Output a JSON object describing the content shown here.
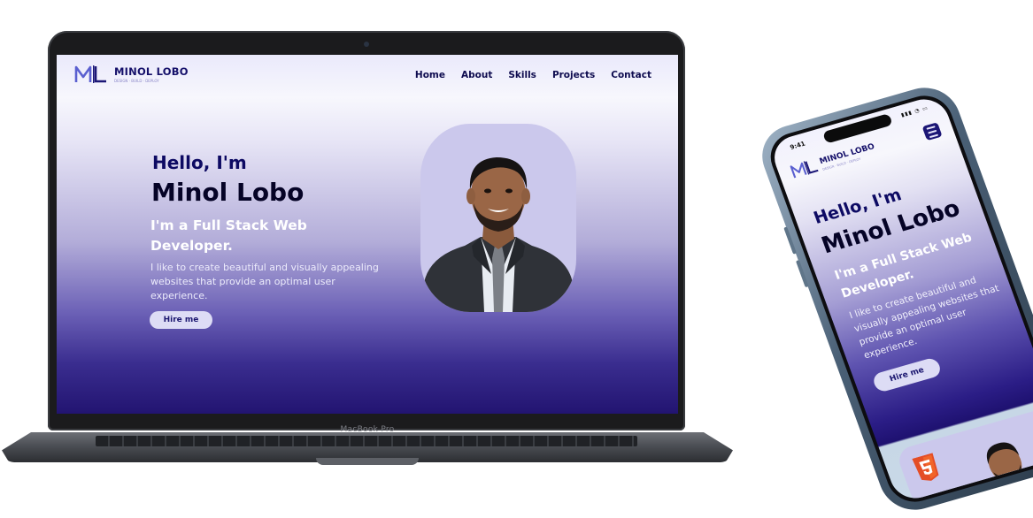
{
  "laptop": {
    "device_label": "MacBook Pro",
    "site": {
      "logo_mark": "ML",
      "logo_name": "MINOL LOBO",
      "logo_tagline": "DESIGN · BUILD · DEPLOY",
      "nav": [
        "Home",
        "About",
        "Skills",
        "Projects",
        "Contact"
      ],
      "hero": {
        "greeting": "Hello, I'm",
        "name": "Minol Lobo",
        "role": "I'm a Full Stack Web Developer.",
        "description": "I like to create beautiful and visually appealing websites that provide an optimal user experience.",
        "cta_label": "Hire me"
      }
    }
  },
  "phone": {
    "status_time": "9:41",
    "status_icons": "▮▮▮ ◔ ▭",
    "site": {
      "logo_mark": "ML",
      "logo_name": "MINOL LOBO",
      "logo_tagline": "DESIGN · BUILD · DEPLOY",
      "hero": {
        "greeting": "Hello, I'm",
        "name": "Minol Lobo",
        "role": "I'm a Full Stack Web Developer.",
        "description": "I like to create beautiful and visually appealing websites that provide an optimal user experience.",
        "cta_label": "Hire me"
      },
      "skill_icon": "html5-icon"
    }
  },
  "colors": {
    "brand_navy": "#15106a",
    "hero_gradient_dark": "#221471",
    "button_bg": "#dddcf5",
    "photo_bg": "#cbc8ec",
    "logo_accent": "#5a5fd0"
  }
}
